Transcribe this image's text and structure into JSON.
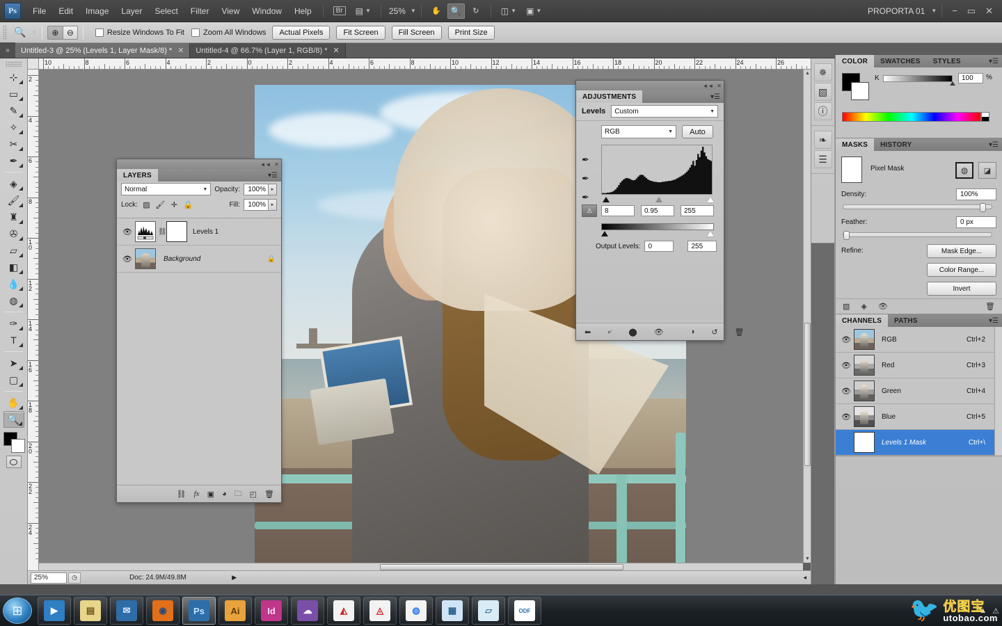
{
  "app": {
    "logo": "Ps",
    "workspace": "PROPORTA 01",
    "zoom_level": "25%",
    "window_buttons": [
      "−",
      "▭",
      "✕"
    ]
  },
  "menubar": {
    "items": [
      "File",
      "Edit",
      "Image",
      "Layer",
      "Select",
      "Filter",
      "View",
      "Window",
      "Help"
    ],
    "bridge_label": "Br",
    "hand_icon": "✋",
    "zoom_icon": "🔍",
    "rotate_icon": "↻"
  },
  "options_bar": {
    "tool_icon": "🔍",
    "zoom_in_label": "⊕",
    "zoom_out_label": "⊖",
    "checkboxes": [
      {
        "label": "Resize Windows To Fit",
        "checked": false
      },
      {
        "label": "Zoom All Windows",
        "checked": false
      }
    ],
    "buttons": [
      "Actual Pixels",
      "Fit Screen",
      "Fill Screen",
      "Print Size"
    ]
  },
  "tabs": [
    {
      "label": "Untitled-3 @ 25% (Levels 1, Layer Mask/8) *",
      "active": true,
      "close": "✕"
    },
    {
      "label": "Untitled-4 @ 66.7% (Layer 1, RGB/8) *",
      "active": false,
      "close": "✕"
    }
  ],
  "toolbar": {
    "tools": [
      {
        "name": "move-tool",
        "glyph": "⊹",
        "selected": false
      },
      {
        "name": "marquee-tool",
        "glyph": "▭",
        "selected": false
      },
      {
        "name": "lasso-tool",
        "glyph": "✎",
        "selected": false
      },
      {
        "name": "quick-selection-tool",
        "glyph": "✧",
        "selected": false
      },
      {
        "name": "crop-tool",
        "glyph": "✂",
        "selected": false
      },
      {
        "name": "eyedropper-tool",
        "glyph": "✒",
        "selected": false
      },
      {
        "name": "spot-healing-tool",
        "glyph": "◈",
        "selected": false
      },
      {
        "name": "brush-tool",
        "glyph": "🖌",
        "selected": false
      },
      {
        "name": "clone-stamp-tool",
        "glyph": "♜",
        "selected": false
      },
      {
        "name": "history-brush-tool",
        "glyph": "✇",
        "selected": false
      },
      {
        "name": "eraser-tool",
        "glyph": "▱",
        "selected": false
      },
      {
        "name": "gradient-tool",
        "glyph": "◧",
        "selected": false
      },
      {
        "name": "blur-tool",
        "glyph": "💧",
        "selected": false
      },
      {
        "name": "dodge-tool",
        "glyph": "◍",
        "selected": false
      },
      {
        "name": "pen-tool",
        "glyph": "✑",
        "selected": false
      },
      {
        "name": "type-tool",
        "glyph": "T",
        "selected": false
      },
      {
        "name": "path-selection-tool",
        "glyph": "➤",
        "selected": false
      },
      {
        "name": "shape-tool",
        "glyph": "▢",
        "selected": false
      },
      {
        "name": "hand-tool",
        "glyph": "✋",
        "selected": false
      },
      {
        "name": "zoom-tool",
        "glyph": "🔍",
        "selected": true
      }
    ],
    "foreground_color": "#000000",
    "background_color": "#ffffff",
    "quickmask_icon": "quick-mask-icon"
  },
  "rulers": {
    "horizontal": [
      "10",
      "8",
      "6",
      "4",
      "2",
      "0",
      "2",
      "4",
      "6",
      "8",
      "10",
      "12",
      "14",
      "16",
      "18",
      "20",
      "22",
      "24",
      "26"
    ],
    "vertical": [
      "2",
      "4",
      "6",
      "8",
      "10",
      "12",
      "14",
      "16",
      "18",
      "20",
      "22",
      "24"
    ],
    "unit": "inches"
  },
  "status_bar": {
    "zoom": "25%",
    "doc_info": "Doc: 24.9M/49.8M",
    "arrow": "▶"
  },
  "layers_panel": {
    "tab": "LAYERS",
    "blend_mode": "Normal",
    "opacity_label": "Opacity:",
    "opacity_value": "100%",
    "lock_label": "Lock:",
    "fill_label": "Fill:",
    "fill_value": "100%",
    "lock_icons": [
      "transparent-pixels-icon",
      "image-pixels-icon",
      "position-icon",
      "all-lock-icon"
    ],
    "layers": [
      {
        "name": "Levels 1",
        "visible": true,
        "italic": false,
        "has_mask": true,
        "locked": false,
        "type": "adjustment"
      },
      {
        "name": "Background",
        "visible": true,
        "italic": true,
        "has_mask": false,
        "locked": true,
        "type": "image"
      }
    ],
    "footer_icons": [
      "link-layers-icon",
      "layer-style-fx-icon",
      "add-mask-icon",
      "new-adjustment-icon",
      "new-group-icon",
      "new-layer-icon",
      "delete-layer-icon"
    ]
  },
  "adjustments_panel": {
    "tab": "ADJUSTMENTS",
    "title": "Levels",
    "preset": "Custom",
    "channel": "RGB",
    "auto_label": "Auto",
    "input_shadow": "8",
    "input_gamma": "0.95",
    "input_highlight": "255",
    "output_label": "Output Levels:",
    "output_black": "0",
    "output_white": "255",
    "eyedropper_icons": [
      "black-point-eyedropper",
      "gray-point-eyedropper",
      "white-point-eyedropper"
    ],
    "footer_icons": [
      "return-to-list-icon",
      "clip-to-layer-icon",
      "toggle-layer-visibility-icon",
      "preview-eye-icon",
      "view-previous-state-icon",
      "reset-icon",
      "delete-adjustment-icon"
    ],
    "histogram": [
      2,
      2,
      2,
      3,
      3,
      4,
      5,
      7,
      10,
      14,
      19,
      24,
      28,
      31,
      33,
      34,
      33,
      32,
      30,
      29,
      30,
      33,
      37,
      40,
      41,
      40,
      37,
      34,
      31,
      29,
      28,
      27,
      26,
      26,
      25,
      25,
      25,
      26,
      26,
      27,
      27,
      28,
      28,
      29,
      30,
      31,
      33,
      35,
      37,
      39,
      41,
      44,
      47,
      51,
      56,
      62,
      70,
      60,
      72,
      85,
      78,
      92,
      100,
      88,
      80,
      74,
      72,
      70
    ]
  },
  "color_panel": {
    "tabs": [
      "COLOR",
      "SWATCHES",
      "STYLES"
    ],
    "active_tab": "COLOR",
    "channel_label": "K",
    "channel_value": "100",
    "percent_symbol": "%",
    "foreground": "#000000",
    "background": "#ffffff"
  },
  "masks_panel": {
    "tabs": [
      "MASKS",
      "HISTORY"
    ],
    "active_tab": "MASKS",
    "mask_type": "Pixel Mask",
    "density_label": "Density:",
    "density_value": "100%",
    "feather_label": "Feather:",
    "feather_value": "0 px",
    "refine_label": "Refine:",
    "buttons": [
      "Mask Edge...",
      "Color Range...",
      "Invert"
    ],
    "footer_icons": [
      "load-selection-icon",
      "apply-mask-icon",
      "disable-mask-icon",
      "delete-mask-icon"
    ]
  },
  "channels_panel": {
    "tabs": [
      "CHANNELS",
      "PATHS"
    ],
    "active_tab": "CHANNELS",
    "channels": [
      {
        "name": "RGB",
        "shortcut": "Ctrl+2",
        "visible": true,
        "selected": false,
        "italic": false
      },
      {
        "name": "Red",
        "shortcut": "Ctrl+3",
        "visible": true,
        "selected": false,
        "italic": false
      },
      {
        "name": "Green",
        "shortcut": "Ctrl+4",
        "visible": true,
        "selected": false,
        "italic": false
      },
      {
        "name": "Blue",
        "shortcut": "Ctrl+5",
        "visible": true,
        "selected": false,
        "italic": false
      },
      {
        "name": "Levels 1 Mask",
        "shortcut": "Ctrl+\\",
        "visible": false,
        "selected": true,
        "italic": true
      }
    ]
  },
  "dock_icons": [
    {
      "name": "navigator-icon",
      "glyph": "✵"
    },
    {
      "name": "histogram-icon",
      "glyph": "▧"
    },
    {
      "name": "info-icon",
      "glyph": "ⓘ"
    },
    {
      "name": "brush-presets-icon",
      "glyph": "❧"
    },
    {
      "name": "tool-presets-icon",
      "glyph": "☰"
    }
  ],
  "taskbar": {
    "start_glyph": "⊞",
    "items": [
      {
        "name": "media-player",
        "label": "▶",
        "bg": "#2f7fc4",
        "fg": "#ffffff",
        "active": false
      },
      {
        "name": "file-explorer",
        "label": "▤",
        "bg": "#e8d48a",
        "fg": "#6b5a20",
        "active": false
      },
      {
        "name": "thunderbird",
        "label": "✉",
        "bg": "#2e6ca8",
        "fg": "#d9eaf7",
        "active": false
      },
      {
        "name": "firefox",
        "label": "◉",
        "bg": "#e2701b",
        "fg": "#2a4b7c",
        "active": false
      },
      {
        "name": "photoshop",
        "label": "Ps",
        "bg": "#2d6ea8",
        "fg": "#bfe3ff",
        "active": true
      },
      {
        "name": "illustrator",
        "label": "Ai",
        "bg": "#e8a33d",
        "fg": "#5c3a05",
        "active": false
      },
      {
        "name": "indesign",
        "label": "Id",
        "bg": "#c0368a",
        "fg": "#ffd9f0",
        "active": false
      },
      {
        "name": "messenger",
        "label": "☁",
        "bg": "#7a4fa8",
        "fg": "#ffffff",
        "active": false
      },
      {
        "name": "acrobat-reader",
        "label": "◭",
        "bg": "#f2f2f2",
        "fg": "#cc2222",
        "active": false
      },
      {
        "name": "acrobat-pro",
        "label": "◬",
        "bg": "#f2f2f2",
        "fg": "#cc2222",
        "active": false
      },
      {
        "name": "chrome",
        "label": "◍",
        "bg": "#f3f3f3",
        "fg": "#2b7de9",
        "active": false
      },
      {
        "name": "control-panel",
        "label": "▦",
        "bg": "#cfe4f5",
        "fg": "#2b5f8f",
        "active": false
      },
      {
        "name": "notes-app",
        "label": "▱",
        "bg": "#d9ecf5",
        "fg": "#4a7f9e",
        "active": false
      },
      {
        "name": "odf-document",
        "label": "ODF",
        "bg": "#ffffff",
        "fg": "#2b6ca8",
        "active": false
      }
    ],
    "tray_glyphs": [
      "▲",
      "🔊",
      "⚠"
    ]
  },
  "watermark": {
    "bird_icon": "bird-logo-icon",
    "chinese_text": "优图宝",
    "url_text": "utobao.com"
  }
}
